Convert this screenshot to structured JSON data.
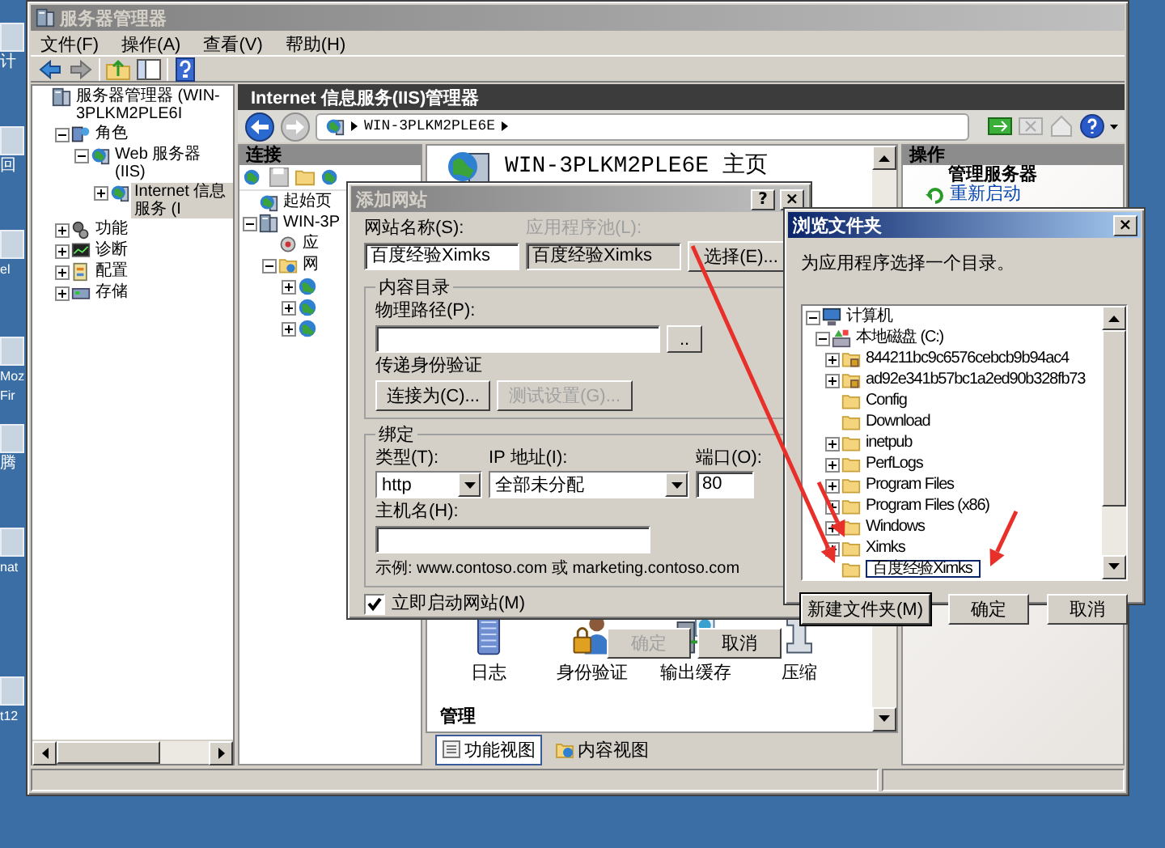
{
  "desktop_icons": [
    {
      "lines": [
        "计"
      ]
    },
    {
      "lines": [
        "回"
      ]
    },
    {
      "lines": [
        "el"
      ]
    },
    {
      "lines": [
        "Moz",
        "Fir"
      ]
    },
    {
      "lines": [
        "腾"
      ]
    },
    {
      "lines": [
        "nat"
      ]
    },
    {
      "lines": [
        "t12"
      ]
    }
  ],
  "server_manager": {
    "title": "服务器管理器",
    "menu": [
      "文件(F)",
      "操作(A)",
      "查看(V)",
      "帮助(H)"
    ],
    "tree": [
      {
        "label": "服务器管理器 (WIN-3PLKM2PLE6I",
        "kind": "server",
        "selected": false,
        "children": [
          {
            "label": "角色",
            "kind": "roles",
            "expanded": true,
            "selected": false,
            "children": [
              {
                "label": "Web 服务器(IIS)",
                "kind": "web",
                "expanded": true,
                "selected": false,
                "children": [
                  {
                    "label": "Internet 信息服务 (I",
                    "kind": "web",
                    "expanded": false,
                    "selected": true
                  }
                ]
              }
            ]
          },
          {
            "label": "功能",
            "kind": "features",
            "expanded": false,
            "selected": false
          },
          {
            "label": "诊断",
            "kind": "diagnostics",
            "expanded": false,
            "selected": false
          },
          {
            "label": "配置",
            "kind": "config",
            "expanded": false,
            "selected": false
          },
          {
            "label": "存储",
            "kind": "storage",
            "expanded": false,
            "selected": false
          }
        ]
      }
    ]
  },
  "iis": {
    "title": "Internet 信息服务(IIS)管理器",
    "address": [
      "WIN-3PLKM2PLE6E"
    ],
    "connections": {
      "title": "连接",
      "tree": [
        {
          "label": "起始页",
          "kind": "start",
          "selected": false
        },
        {
          "label": "WIN-3P",
          "kind": "server",
          "expanded": true,
          "selected": false,
          "children": [
            {
              "label": "应",
              "kind": "pool",
              "selected": false
            },
            {
              "label": "网",
              "kind": "sites",
              "expanded": true,
              "selected": false,
              "children": [
                {
                  "kind": "globe",
                  "expanded": false,
                  "selected": false
                },
                {
                  "kind": "globe",
                  "expanded": false,
                  "selected": false
                },
                {
                  "kind": "globe",
                  "expanded": false,
                  "selected": false
                }
              ]
            }
          ]
        }
      ]
    },
    "center": {
      "heading": "WIN-3PLKM2PLE6E 主页",
      "features": [
        {
          "label": "日志",
          "kind": "log"
        },
        {
          "label": "身份验证",
          "kind": "auth"
        },
        {
          "label": "输出缓存",
          "kind": "cache"
        },
        {
          "label": "压缩",
          "kind": "compress"
        }
      ],
      "section": "管理",
      "view_tabs": [
        {
          "label": "功能视图",
          "selected": true
        },
        {
          "label": "内容视图",
          "selected": false
        }
      ]
    },
    "actions": {
      "title": "操作",
      "heading": "管理服务器",
      "links": [
        "重新启动"
      ]
    }
  },
  "add_site": {
    "title": "添加网站",
    "title_buttons": [
      "?",
      "×"
    ],
    "site_name": {
      "label": "网站名称(S):",
      "value": "百度经验Ximks"
    },
    "app_pool": {
      "label": "应用程序池(L):",
      "value": "百度经验Ximks",
      "disabled": true
    },
    "select_button": "选择(E)...",
    "content_dir": {
      "title": "内容目录",
      "path_label": "物理路径(P):",
      "browse_button": "..",
      "auth_label": "传递身份验证",
      "connect_button": {
        "label": "连接为(C)...",
        "disabled": false
      },
      "test_button": {
        "label": "测试设置(G)...",
        "disabled": true
      }
    },
    "binding": {
      "title": "绑定",
      "type": {
        "label": "类型(T):",
        "value": "http"
      },
      "ip": {
        "label": "IP 地址(I):",
        "value": "全部未分配"
      },
      "port": {
        "label": "端口(O):",
        "value": "80"
      },
      "host": {
        "label": "主机名(H):"
      },
      "example": "示例: www.contoso.com 或 marketing.contoso.com"
    },
    "start_now": {
      "label": "立即启动网站(M)",
      "checked": true
    },
    "buttons": [
      {
        "label": "确定",
        "disabled": true
      },
      {
        "label": "取消",
        "disabled": false
      }
    ]
  },
  "browse": {
    "title": "浏览文件夹",
    "title_buttons": [
      "×"
    ],
    "prompt": "为应用程序选择一个目录。",
    "tree": [
      {
        "label": "计算机",
        "kind": "computer",
        "expanded": true,
        "selected": false,
        "children": [
          {
            "label": "本地磁盘 (C:)",
            "kind": "drive",
            "expanded": true,
            "selected": false,
            "children": [
              {
                "label": "844211bc9c6576cebcb9b94ac4",
                "kind": "locked-folder",
                "expanded": false,
                "selected": false
              },
              {
                "label": "ad92e341b57bc1a2ed90b328fb73",
                "kind": "locked-folder",
                "expanded": false,
                "selected": false
              },
              {
                "label": "Config",
                "kind": "folder",
                "selected": false
              },
              {
                "label": "Download",
                "kind": "folder",
                "selected": false
              },
              {
                "label": "inetpub",
                "kind": "folder",
                "expanded": false,
                "selected": false
              },
              {
                "label": "PerfLogs",
                "kind": "folder",
                "expanded": false,
                "selected": false
              },
              {
                "label": "Program Files",
                "kind": "folder",
                "expanded": false,
                "selected": false
              },
              {
                "label": "Program Files (x86)",
                "kind": "folder",
                "expanded": false,
                "selected": false
              },
              {
                "label": "Windows",
                "kind": "folder",
                "expanded": false,
                "selected": false
              },
              {
                "label": "Ximks",
                "kind": "folder",
                "expanded": false,
                "selected": false
              },
              {
                "label": "百度经验Ximks",
                "kind": "new-folder",
                "selected": true
              }
            ]
          }
        ]
      }
    ],
    "buttons": [
      {
        "label": "新建文件夹(M)",
        "focused": true
      },
      {
        "label": "确定",
        "focused": false
      },
      {
        "label": "取消",
        "focused": false
      }
    ]
  }
}
